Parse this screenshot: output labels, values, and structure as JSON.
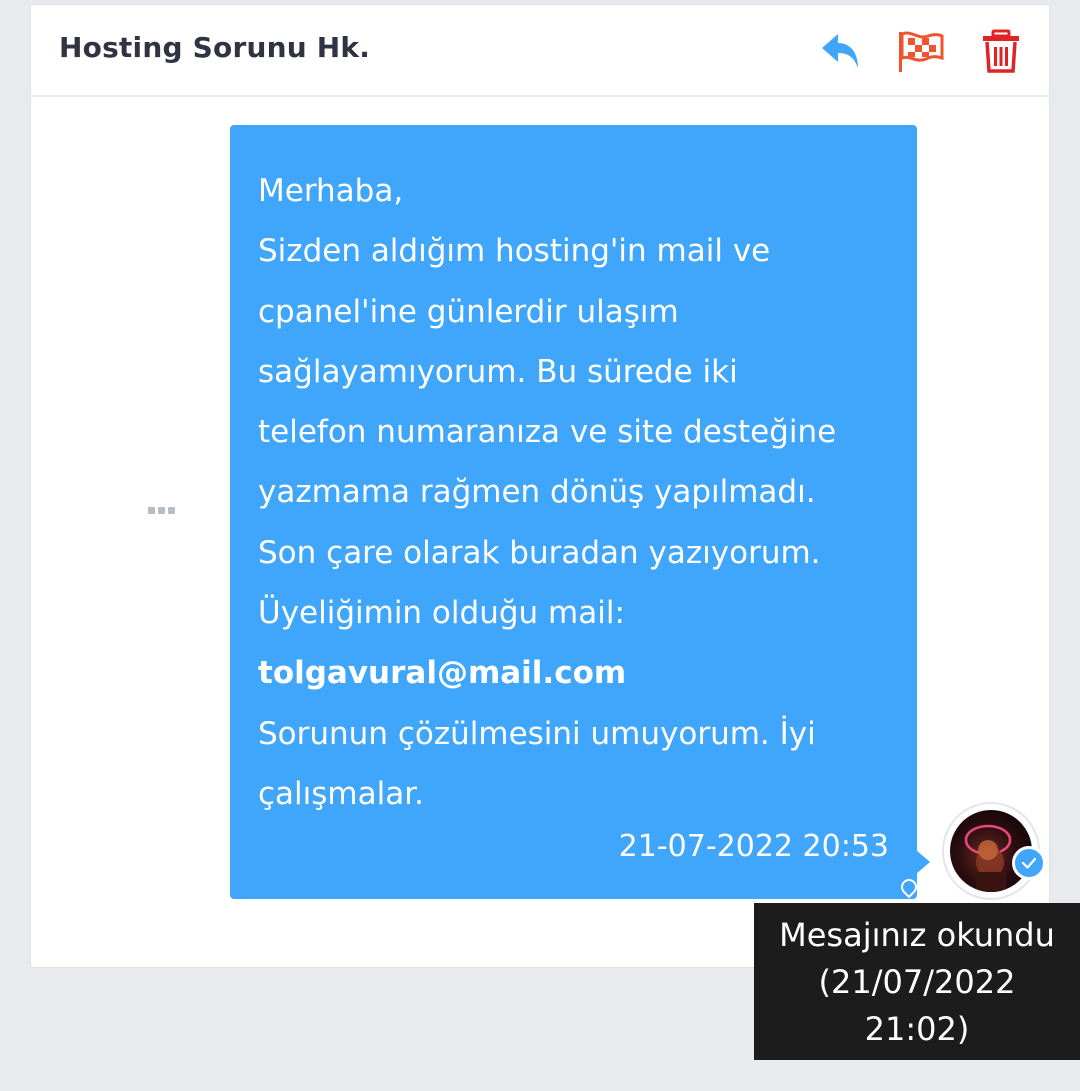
{
  "header": {
    "title": "Hosting Sorunu Hk.",
    "actions": [
      {
        "icon": "reply-icon",
        "color": "#3fa6fb"
      },
      {
        "icon": "flag-icon",
        "color": "#f0532e"
      },
      {
        "icon": "trash-icon",
        "color": "#e02424"
      }
    ]
  },
  "message": {
    "lines": [
      "Merhaba,",
      "Sizden aldığım hosting'in mail ve",
      "cpanel'ine günlerdir ulaşım",
      "sağlayamıyorum. Bu sürede iki",
      "telefon numaranıza ve site desteğine",
      "yazmama rağmen dönüş yapılmadı.",
      "Son çare olarak buradan yazıyorum.",
      "Üyeliğimin olduğu mail:",
      "tolgavural@mail.com",
      "Sorunun çözülmesini umuyorum. İyi",
      "çalışmalar."
    ],
    "timestamp": "21-07-2022 20:53",
    "bubble_color": "#3fa6fb"
  },
  "more_menu": {
    "icon": "more-dots-icon"
  },
  "avatar": {
    "icon": "avatar",
    "read_badge_icon": "check-icon"
  },
  "tooltip": {
    "lines": [
      "Mesajınız okundu",
      "(21/07/2022",
      "21:02)"
    ]
  }
}
